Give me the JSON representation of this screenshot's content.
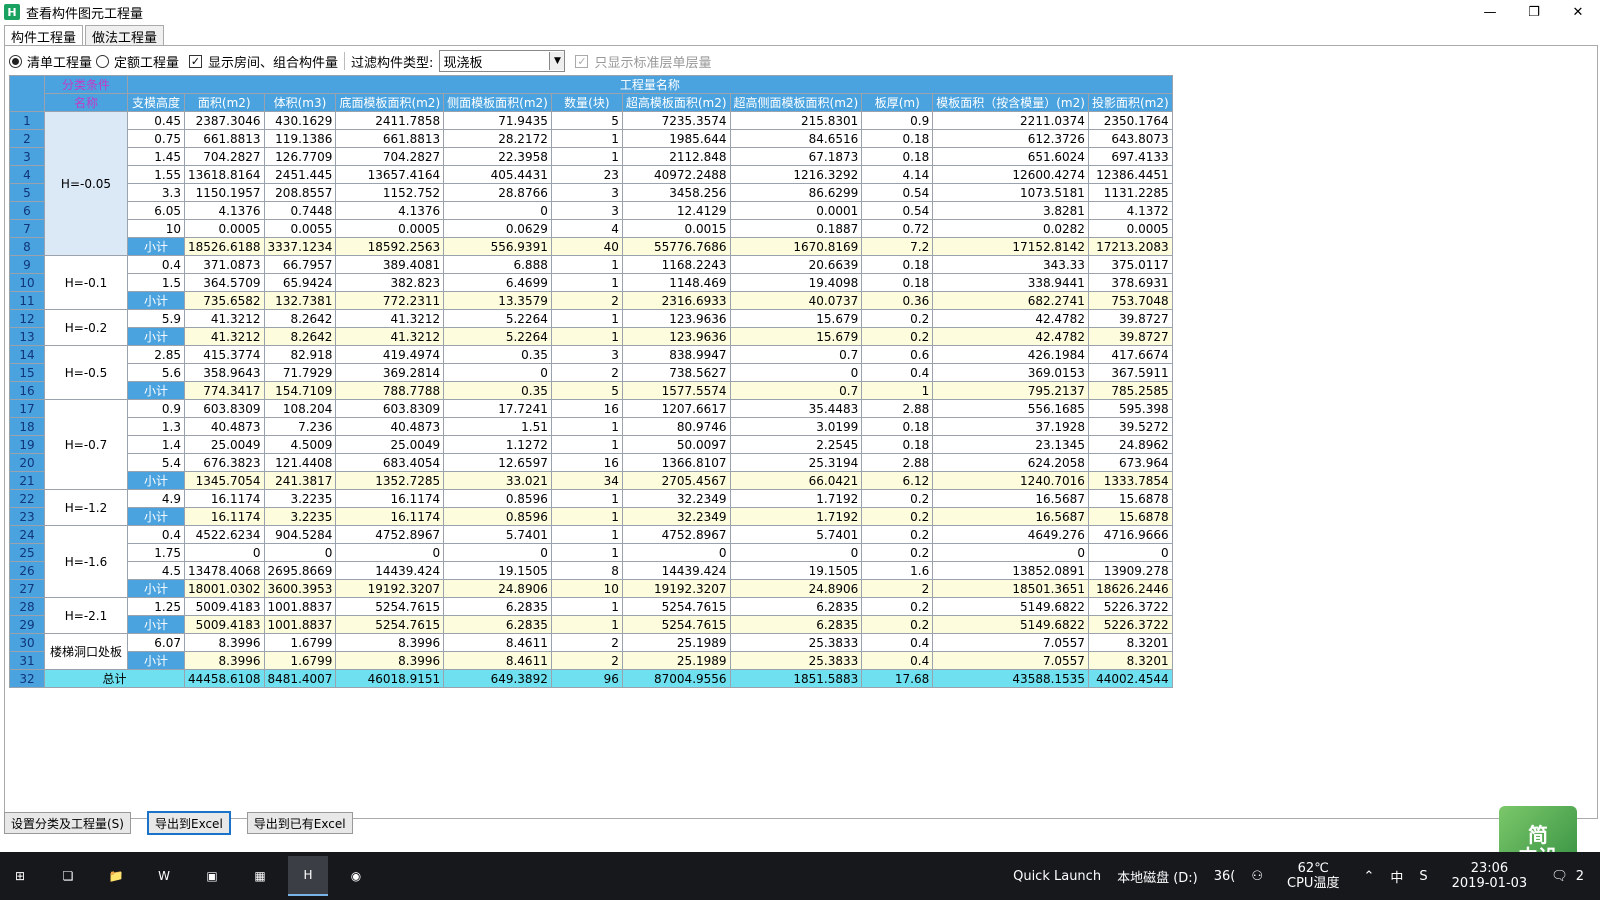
{
  "window": {
    "title": "查看构件图元工程量",
    "minimize": "—",
    "maximize": "❐",
    "close": "✕"
  },
  "tabs": [
    {
      "label": "构件工程量"
    },
    {
      "label": "做法工程量"
    }
  ],
  "toolbar": {
    "radio1": "清单工程量",
    "radio2": "定额工程量",
    "check1": "显示房间、组合构件量",
    "filter_label": "过滤构件类型:",
    "filter_value": "现浇板",
    "check2": "只显示标准层单层量"
  },
  "table": {
    "group_headers": {
      "classify": "分类条件",
      "quantity": "工程量名称"
    },
    "columns": [
      "名称",
      "支模高度",
      "面积(m2)",
      "体积(m3)",
      "底面模板面积(m2)",
      "侧面模板面积(m2)",
      "数量(块)",
      "超高模板面积(m2)",
      "超高侧面模板面积(m2)",
      "板厚(m)",
      "模板面积（按含模量）(m2)",
      "投影面积(m2)"
    ],
    "groups": [
      {
        "name": "H=-0.05",
        "rows": [
          [
            "1",
            "0.45",
            "2387.3046",
            "430.1629",
            "2411.7858",
            "71.9435",
            "5",
            "7235.3574",
            "215.8301",
            "0.9",
            "2211.0374",
            "2350.1764"
          ],
          [
            "2",
            "0.75",
            "661.8813",
            "119.1386",
            "661.8813",
            "28.2172",
            "1",
            "1985.644",
            "84.6516",
            "0.18",
            "612.3726",
            "643.8073"
          ],
          [
            "3",
            "1.45",
            "704.2827",
            "126.7709",
            "704.2827",
            "22.3958",
            "1",
            "2112.848",
            "67.1873",
            "0.18",
            "651.6024",
            "697.4133"
          ],
          [
            "4",
            "1.55",
            "13618.8164",
            "2451.445",
            "13657.4164",
            "405.4431",
            "23",
            "40972.2488",
            "1216.3292",
            "4.14",
            "12600.4274",
            "12386.4451"
          ],
          [
            "5",
            "3.3",
            "1150.1957",
            "208.8557",
            "1152.752",
            "28.8766",
            "3",
            "3458.256",
            "86.6299",
            "0.54",
            "1073.5181",
            "1131.2285"
          ],
          [
            "6",
            "6.05",
            "4.1376",
            "0.7448",
            "4.1376",
            "0",
            "3",
            "12.4129",
            "0.0001",
            "0.54",
            "3.8281",
            "4.1372"
          ],
          [
            "7",
            "10",
            "0.0005",
            "0.0055",
            "0.0005",
            "0.0629",
            "4",
            "0.0015",
            "0.1887",
            "0.72",
            "0.0282",
            "0.0005"
          ],
          [
            "8",
            "小计",
            "18526.6188",
            "3337.1234",
            "18592.2563",
            "556.9391",
            "40",
            "55776.7686",
            "1670.8169",
            "7.2",
            "17152.8142",
            "17213.2083"
          ]
        ]
      },
      {
        "name": "H=-0.1",
        "rows": [
          [
            "9",
            "0.4",
            "371.0873",
            "66.7957",
            "389.4081",
            "6.888",
            "1",
            "1168.2243",
            "20.6639",
            "0.18",
            "343.33",
            "375.0117"
          ],
          [
            "10",
            "1.5",
            "364.5709",
            "65.9424",
            "382.823",
            "6.4699",
            "1",
            "1148.469",
            "19.4098",
            "0.18",
            "338.9441",
            "378.6931"
          ],
          [
            "11",
            "小计",
            "735.6582",
            "132.7381",
            "772.2311",
            "13.3579",
            "2",
            "2316.6933",
            "40.0737",
            "0.36",
            "682.2741",
            "753.7048"
          ]
        ]
      },
      {
        "name": "H=-0.2",
        "rows": [
          [
            "12",
            "5.9",
            "41.3212",
            "8.2642",
            "41.3212",
            "5.2264",
            "1",
            "123.9636",
            "15.679",
            "0.2",
            "42.4782",
            "39.8727"
          ],
          [
            "13",
            "小计",
            "41.3212",
            "8.2642",
            "41.3212",
            "5.2264",
            "1",
            "123.9636",
            "15.679",
            "0.2",
            "42.4782",
            "39.8727"
          ]
        ]
      },
      {
        "name": "H=-0.5",
        "rows": [
          [
            "14",
            "2.85",
            "415.3774",
            "82.918",
            "419.4974",
            "0.35",
            "3",
            "838.9947",
            "0.7",
            "0.6",
            "426.1984",
            "417.6674"
          ],
          [
            "15",
            "5.6",
            "358.9643",
            "71.7929",
            "369.2814",
            "0",
            "2",
            "738.5627",
            "0",
            "0.4",
            "369.0153",
            "367.5911"
          ],
          [
            "16",
            "小计",
            "774.3417",
            "154.7109",
            "788.7788",
            "0.35",
            "5",
            "1577.5574",
            "0.7",
            "1",
            "795.2137",
            "785.2585"
          ]
        ]
      },
      {
        "name": "H=-0.7",
        "rows": [
          [
            "17",
            "0.9",
            "603.8309",
            "108.204",
            "603.8309",
            "17.7241",
            "16",
            "1207.6617",
            "35.4483",
            "2.88",
            "556.1685",
            "595.398"
          ],
          [
            "18",
            "1.3",
            "40.4873",
            "7.236",
            "40.4873",
            "1.51",
            "1",
            "80.9746",
            "3.0199",
            "0.18",
            "37.1928",
            "39.5272"
          ],
          [
            "19",
            "1.4",
            "25.0049",
            "4.5009",
            "25.0049",
            "1.1272",
            "1",
            "50.0097",
            "2.2545",
            "0.18",
            "23.1345",
            "24.8962"
          ],
          [
            "20",
            "5.4",
            "676.3823",
            "121.4408",
            "683.4054",
            "12.6597",
            "16",
            "1366.8107",
            "25.3194",
            "2.88",
            "624.2058",
            "673.964"
          ],
          [
            "21",
            "小计",
            "1345.7054",
            "241.3817",
            "1352.7285",
            "33.021",
            "34",
            "2705.4567",
            "66.0421",
            "6.12",
            "1240.7016",
            "1333.7854"
          ]
        ]
      },
      {
        "name": "H=-1.2",
        "rows": [
          [
            "22",
            "4.9",
            "16.1174",
            "3.2235",
            "16.1174",
            "0.8596",
            "1",
            "32.2349",
            "1.7192",
            "0.2",
            "16.5687",
            "15.6878"
          ],
          [
            "23",
            "小计",
            "16.1174",
            "3.2235",
            "16.1174",
            "0.8596",
            "1",
            "32.2349",
            "1.7192",
            "0.2",
            "16.5687",
            "15.6878"
          ]
        ]
      },
      {
        "name": "H=-1.6",
        "rows": [
          [
            "24",
            "0.4",
            "4522.6234",
            "904.5284",
            "4752.8967",
            "5.7401",
            "1",
            "4752.8967",
            "5.7401",
            "0.2",
            "4649.276",
            "4716.9666"
          ],
          [
            "25",
            "1.75",
            "0",
            "0",
            "0",
            "0",
            "1",
            "0",
            "0",
            "0.2",
            "0",
            "0"
          ],
          [
            "26",
            "4.5",
            "13478.4068",
            "2695.8669",
            "14439.424",
            "19.1505",
            "8",
            "14439.424",
            "19.1505",
            "1.6",
            "13852.0891",
            "13909.278"
          ],
          [
            "27",
            "小计",
            "18001.0302",
            "3600.3953",
            "19192.3207",
            "24.8906",
            "10",
            "19192.3207",
            "24.8906",
            "2",
            "18501.3651",
            "18626.2446"
          ]
        ]
      },
      {
        "name": "H=-2.1",
        "rows": [
          [
            "28",
            "1.25",
            "5009.4183",
            "1001.8837",
            "5254.7615",
            "6.2835",
            "1",
            "5254.7615",
            "6.2835",
            "0.2",
            "5149.6822",
            "5226.3722"
          ],
          [
            "29",
            "小计",
            "5009.4183",
            "1001.8837",
            "5254.7615",
            "6.2835",
            "1",
            "5254.7615",
            "6.2835",
            "0.2",
            "5149.6822",
            "5226.3722"
          ]
        ]
      },
      {
        "name": "楼梯洞口处板",
        "rows": [
          [
            "30",
            "6.07",
            "8.3996",
            "1.6799",
            "8.3996",
            "8.4611",
            "2",
            "25.1989",
            "25.3833",
            "0.4",
            "7.0557",
            "8.3201"
          ],
          [
            "31",
            "小计",
            "8.3996",
            "1.6799",
            "8.3996",
            "8.4611",
            "2",
            "25.1989",
            "25.3833",
            "0.4",
            "7.0557",
            "8.3201"
          ]
        ]
      }
    ],
    "total": [
      "32",
      "总计",
      "44458.6108",
      "8481.4007",
      "46018.9151",
      "649.3892",
      "96",
      "87004.9556",
      "1851.5883",
      "17.68",
      "43588.1535",
      "44002.4544"
    ]
  },
  "buttons": {
    "setup": "设置分类及工程量(S)",
    "export": "导出到Excel",
    "export_existing": "导出到已有Excel"
  },
  "deco": {
    "line1": "简",
    "line2": "中设"
  },
  "taskbar": {
    "quick_launch": "Quick Launch",
    "disk": "本地磁盘 (D:)",
    "app360": "36(",
    "temp": "62℃",
    "temp_label": "CPU温度",
    "ime": "中",
    "time": "23:06",
    "date": "2019-01-03",
    "notif": "2"
  }
}
